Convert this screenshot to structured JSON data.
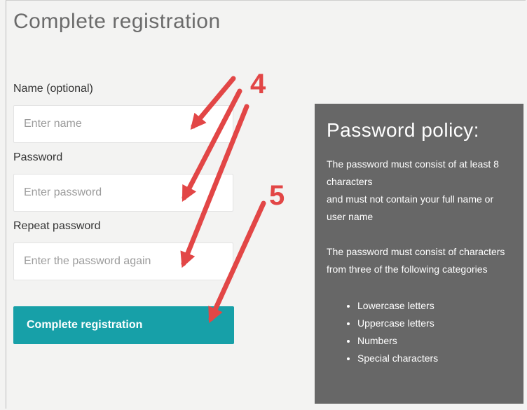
{
  "page": {
    "title": "Complete registration"
  },
  "form": {
    "name": {
      "label": "Name (optional)",
      "placeholder": "Enter name"
    },
    "password": {
      "label": "Password",
      "placeholder": "Enter password"
    },
    "repeat_password": {
      "label": "Repeat password",
      "placeholder": "Enter the password again"
    },
    "submit_label": "Complete registration"
  },
  "policy": {
    "title": "Password policy:",
    "line1": "The password must consist of at least 8 characters",
    "line2": "and must not contain your full name or user name",
    "line3": "The password must consist of characters from three of the following categories",
    "categories": [
      "Lowercase letters",
      "Uppercase letters",
      "Numbers",
      "Special characters"
    ]
  },
  "annotations": {
    "step_4": "4",
    "step_5": "5",
    "arrow_color": "#e24646"
  },
  "colors": {
    "accent": "#17a0a8",
    "policy_bg": "#676767"
  }
}
